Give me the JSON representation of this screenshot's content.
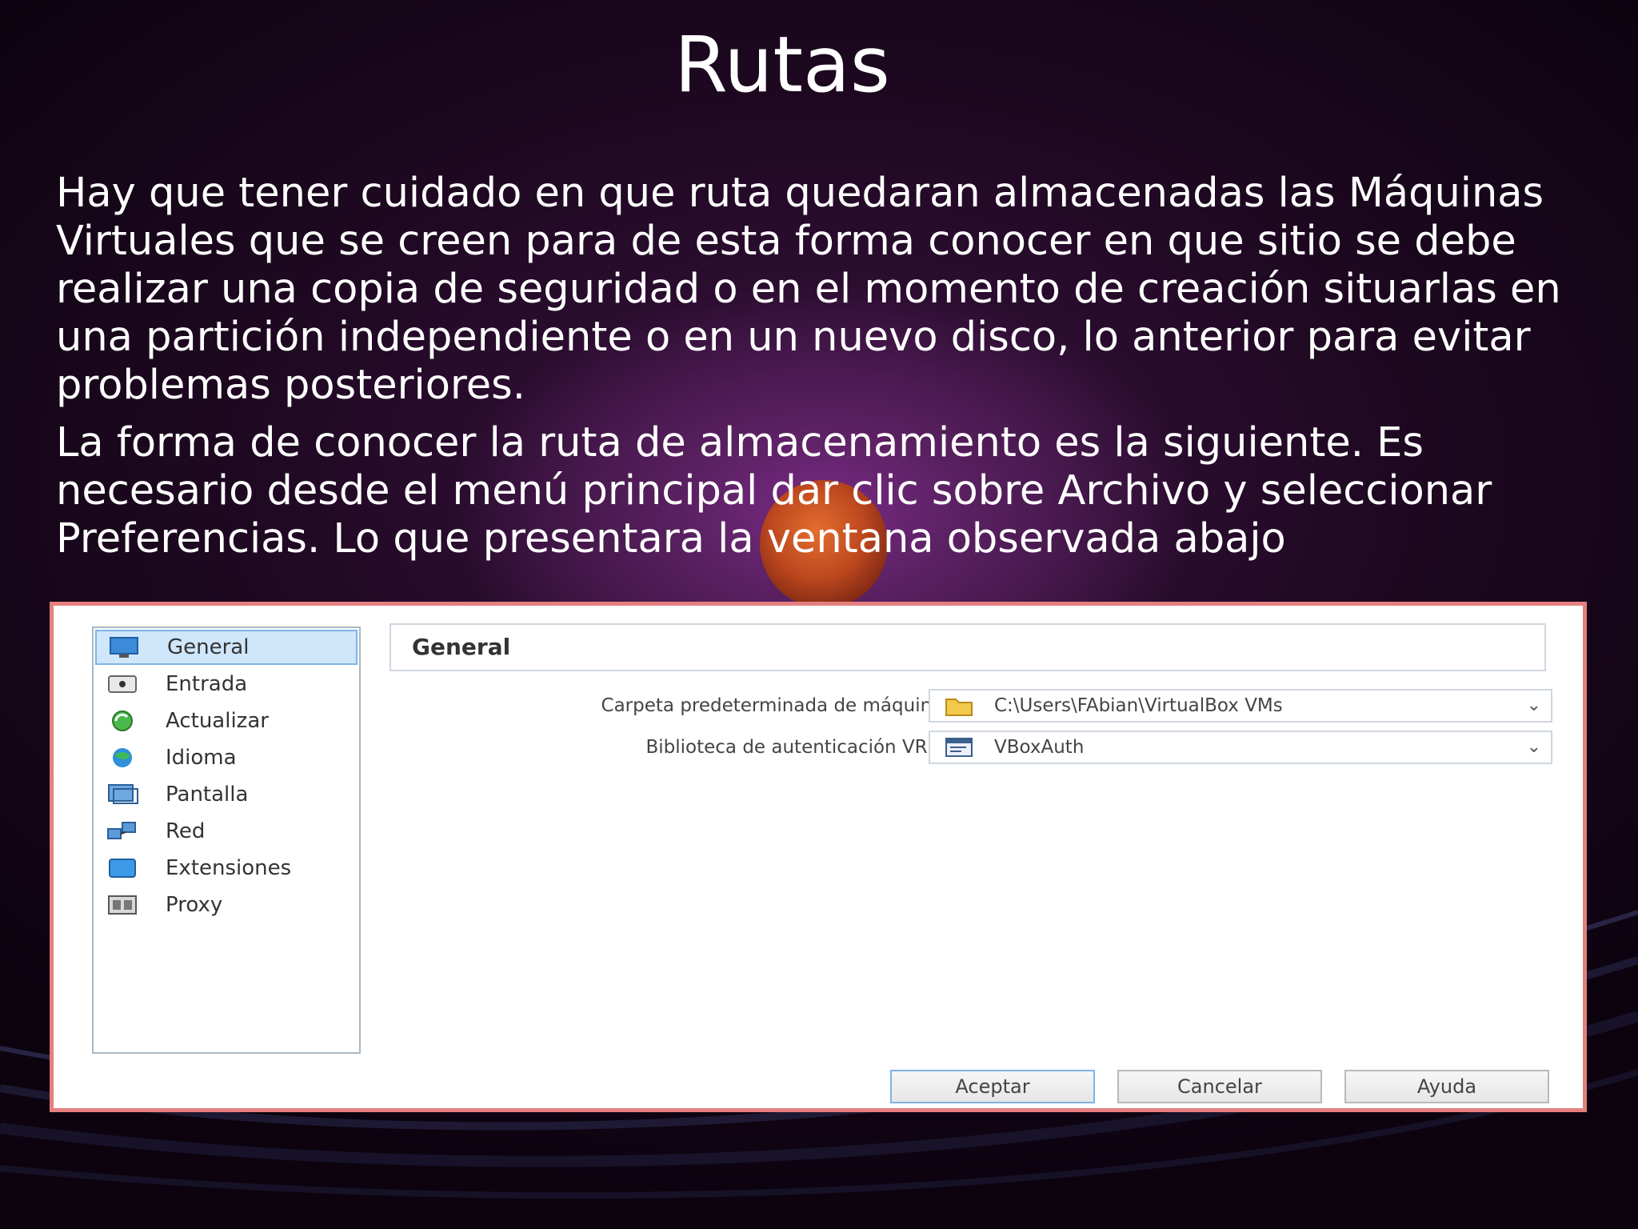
{
  "slide": {
    "title": "Rutas",
    "paragraphs": [
      "Hay que tener cuidado en que ruta quedaran almacenadas las Máquinas Virtuales que se creen para de esta forma conocer en que sitio se debe realizar una copia de seguridad o en el momento de creación situarlas en una partición independiente o en un nuevo disco, lo anterior para evitar problemas posteriores.",
      "La forma de conocer la ruta de almacenamiento es la siguiente. Es necesario desde el menú principal dar clic sobre Archivo y seleccionar Preferencias. Lo que presentara la ventana observada abajo"
    ]
  },
  "dialog": {
    "sidebar": {
      "items": [
        {
          "label": "General",
          "icon": "monitor-icon",
          "selected": true
        },
        {
          "label": "Entrada",
          "icon": "keyboard-icon",
          "selected": false
        },
        {
          "label": "Actualizar",
          "icon": "update-icon",
          "selected": false
        },
        {
          "label": "Idioma",
          "icon": "globe-icon",
          "selected": false
        },
        {
          "label": "Pantalla",
          "icon": "display-icon",
          "selected": false
        },
        {
          "label": "Red",
          "icon": "network-icon",
          "selected": false
        },
        {
          "label": "Extensiones",
          "icon": "extensions-icon",
          "selected": false
        },
        {
          "label": "Proxy",
          "icon": "proxy-icon",
          "selected": false
        }
      ]
    },
    "section_title": "General",
    "fields": {
      "machine_folder": {
        "label": "Carpeta predeterminada de máquinas:",
        "value": "C:\\Users\\FAbian\\VirtualBox VMs",
        "icon": "folder-icon"
      },
      "vrdp_library": {
        "label": "Biblioteca de autenticación VRDP:",
        "value": "VBoxAuth",
        "icon": "library-icon"
      }
    },
    "buttons": {
      "accept": "Aceptar",
      "cancel": "Cancelar",
      "help": "Ayuda"
    }
  },
  "colors": {
    "dialog_border": "#e57f7f",
    "selection_bg": "#cfe6fb",
    "background_purple": "#58205f"
  }
}
